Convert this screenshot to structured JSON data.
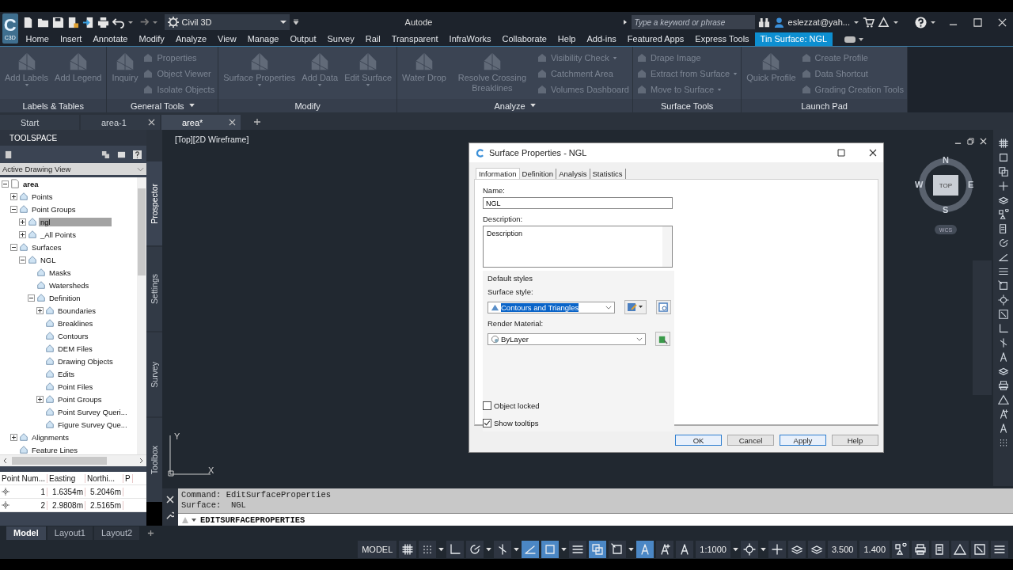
{
  "app_bar": {
    "logo": {
      "letter": "C",
      "caption": "C3D"
    },
    "workspace": "Civil 3D",
    "title": "Autode",
    "search_placeholder": "Type a keyword or phrase",
    "user": "eslezzat@yah..."
  },
  "ribbon_tabs": [
    {
      "label": "Home",
      "selected": false
    },
    {
      "label": "Insert",
      "selected": false
    },
    {
      "label": "Annotate",
      "selected": false
    },
    {
      "label": "Modify",
      "selected": false
    },
    {
      "label": "Analyze",
      "selected": false
    },
    {
      "label": "View",
      "selected": false
    },
    {
      "label": "Manage",
      "selected": false
    },
    {
      "label": "Output",
      "selected": false
    },
    {
      "label": "Survey",
      "selected": false
    },
    {
      "label": "Rail",
      "selected": false
    },
    {
      "label": "Transparent",
      "selected": false
    },
    {
      "label": "InfraWorks",
      "selected": false
    },
    {
      "label": "Collaborate",
      "selected": false
    },
    {
      "label": "Help",
      "selected": false
    },
    {
      "label": "Add-ins",
      "selected": false
    },
    {
      "label": "Featured Apps",
      "selected": false
    },
    {
      "label": "Express Tools",
      "selected": false
    },
    {
      "label": "Tin Surface: NGL",
      "selected": true
    }
  ],
  "ribbon_panels": [
    {
      "title": "Labels & Tables",
      "has_menu": false,
      "disabled": true,
      "tools": [
        {
          "label": "Add Labels",
          "kind": "large",
          "dropdown": true
        },
        {
          "label": "Add Legend",
          "kind": "large",
          "dropdown": false
        }
      ]
    },
    {
      "title": "General Tools",
      "has_menu": true,
      "disabled": true,
      "tools": [
        {
          "label": "Inquiry",
          "kind": "large",
          "dropdown": false
        },
        {
          "label": "Properties",
          "kind": "small",
          "dropdown": false
        },
        {
          "label": "Object Viewer",
          "kind": "small",
          "dropdown": false
        },
        {
          "label": "Isolate Objects",
          "kind": "small",
          "dropdown": false
        }
      ]
    },
    {
      "title": "Modify",
      "has_menu": false,
      "disabled": true,
      "tools": [
        {
          "label": "Surface Properties",
          "kind": "large",
          "dropdown": true
        },
        {
          "label": "Add Data",
          "kind": "large",
          "dropdown": true
        },
        {
          "label": "Edit Surface",
          "kind": "large",
          "dropdown": true
        }
      ]
    },
    {
      "title": "Analyze",
      "has_menu": true,
      "disabled": true,
      "tools": [
        {
          "label": "Water Drop",
          "kind": "large",
          "dropdown": false
        },
        {
          "label": "Resolve Crossing Breaklines",
          "kind": "large",
          "dropdown": false
        },
        {
          "label": "Visibility Check",
          "kind": "small",
          "dropdown": true
        },
        {
          "label": "Catchment Area",
          "kind": "small",
          "dropdown": false
        },
        {
          "label": "Volumes Dashboard",
          "kind": "small",
          "dropdown": false
        }
      ]
    },
    {
      "title": "Surface Tools",
      "has_menu": false,
      "disabled": true,
      "tools": [
        {
          "label": "Drape Image",
          "kind": "small",
          "dropdown": false
        },
        {
          "label": "Extract from Surface",
          "kind": "small",
          "dropdown": true
        },
        {
          "label": "Move to Surface",
          "kind": "small",
          "dropdown": true
        }
      ]
    },
    {
      "title": "Launch Pad",
      "has_menu": false,
      "disabled": true,
      "tools": [
        {
          "label": "Quick Profile",
          "kind": "large",
          "dropdown": false
        },
        {
          "label": "Create Profile",
          "kind": "small",
          "dropdown": false
        },
        {
          "label": "Data Shortcut",
          "kind": "small",
          "dropdown": false
        },
        {
          "label": "Grading Creation Tools",
          "kind": "small",
          "dropdown": false
        }
      ]
    }
  ],
  "doc_tabs": [
    {
      "label": "Start",
      "selected": false,
      "closable": false
    },
    {
      "label": "area-1",
      "selected": false,
      "closable": true
    },
    {
      "label": "area*",
      "selected": true,
      "closable": true
    }
  ],
  "toolspace": {
    "title": "TOOLSPACE",
    "view": "Active Drawing View",
    "tree": [
      {
        "label": "area",
        "expanded": true,
        "selected": false,
        "children": [
          {
            "label": "Points",
            "expanded": false,
            "selected": false
          },
          {
            "label": "Point Groups",
            "expanded": true,
            "selected": false,
            "children": [
              {
                "label": "ngl",
                "expanded": false,
                "selected": true
              },
              {
                "label": "_All Points",
                "expanded": false,
                "selected": false
              }
            ]
          },
          {
            "label": "Surfaces",
            "expanded": true,
            "selected": false,
            "children": [
              {
                "label": "NGL",
                "expanded": true,
                "selected": false,
                "children": [
                  {
                    "label": "Masks",
                    "selected": false
                  },
                  {
                    "label": "Watersheds",
                    "selected": false
                  },
                  {
                    "label": "Definition",
                    "expanded": true,
                    "selected": false,
                    "children": [
                      {
                        "label": "Boundaries",
                        "expanded": false,
                        "selected": false
                      },
                      {
                        "label": "Breaklines",
                        "selected": false
                      },
                      {
                        "label": "Contours",
                        "selected": false
                      },
                      {
                        "label": "DEM Files",
                        "selected": false
                      },
                      {
                        "label": "Drawing Objects",
                        "selected": false
                      },
                      {
                        "label": "Edits",
                        "selected": false
                      },
                      {
                        "label": "Point Files",
                        "selected": false
                      },
                      {
                        "label": "Point Groups",
                        "expanded": false,
                        "selected": false
                      },
                      {
                        "label": "Point Survey Queri...",
                        "selected": false
                      },
                      {
                        "label": "Figure Survey Que...",
                        "selected": false
                      }
                    ]
                  }
                ]
              }
            ]
          },
          {
            "label": "Alignments",
            "expanded": false,
            "selected": false
          },
          {
            "label": "Feature Lines",
            "selected": false
          }
        ]
      }
    ],
    "side_tabs": [
      {
        "label": "Prospector",
        "selected": true
      },
      {
        "label": "Settings",
        "selected": false
      },
      {
        "label": "Survey",
        "selected": false
      },
      {
        "label": "Toolbox",
        "selected": false
      }
    ]
  },
  "points_table": {
    "columns": [
      "Point Num...",
      "Easting",
      "Northi...",
      "P"
    ],
    "rows": [
      [
        "1",
        "1.6354m",
        "5.2046m",
        ""
      ],
      [
        "2",
        "2.9808m",
        "2.5165m",
        ""
      ]
    ]
  },
  "viewport": {
    "label": "[Top][2D Wireframe]",
    "viewcube": {
      "north": "N",
      "south": "S",
      "east": "E",
      "west": "W",
      "top": "TOP",
      "ucs": "WCS"
    },
    "axes": {
      "x": "X",
      "y": "Y"
    }
  },
  "dialog": {
    "title": "Surface Properties - NGL",
    "tabs": [
      {
        "label": "Information",
        "selected": true
      },
      {
        "label": "Definition",
        "selected": false
      },
      {
        "label": "Analysis",
        "selected": false
      },
      {
        "label": "Statistics",
        "selected": false
      }
    ],
    "name_label": "Name:",
    "name": "NGL",
    "description_label": "Description:",
    "description": "Description",
    "group_title": "Default styles",
    "surface_style_label": "Surface style:",
    "surface_style": "Contours and Triangles",
    "surface_style_highlighted": true,
    "render_material_label": "Render Material:",
    "render_material": "ByLayer",
    "checkboxes": [
      {
        "label": "Object locked",
        "checked": false
      },
      {
        "label": "Show tooltips",
        "checked": true
      }
    ],
    "buttons": [
      {
        "label": "OK",
        "highlighted": true
      },
      {
        "label": "Cancel",
        "highlighted": false
      },
      {
        "label": "Apply",
        "highlighted": true
      },
      {
        "label": "Help",
        "highlighted": false
      }
    ]
  },
  "command_line": {
    "history": [
      "Command: EditSurfaceProperties",
      "Surface:  NGL"
    ],
    "input": "EDITSURFACEPROPERTIES"
  },
  "layout_tabs": [
    {
      "label": "Model",
      "selected": true
    },
    {
      "label": "Layout1",
      "selected": false
    },
    {
      "label": "Layout2",
      "selected": false
    }
  ],
  "status_bar": [
    {
      "kind": "text",
      "label": "MODEL"
    },
    {
      "kind": "icon",
      "on": false
    },
    {
      "kind": "icon",
      "on": false
    },
    {
      "kind": "caret"
    },
    {
      "kind": "icon",
      "on": false
    },
    {
      "kind": "icon",
      "on": false
    },
    {
      "kind": "caret"
    },
    {
      "kind": "icon",
      "on": false
    },
    {
      "kind": "caret"
    },
    {
      "kind": "icon",
      "on": true
    },
    {
      "kind": "icon",
      "on": true
    },
    {
      "kind": "caret"
    },
    {
      "kind": "icon",
      "on": false
    },
    {
      "kind": "icon",
      "on": true
    },
    {
      "kind": "icon",
      "on": false
    },
    {
      "kind": "caret"
    },
    {
      "kind": "icon",
      "on": true
    },
    {
      "kind": "icon",
      "on": false
    },
    {
      "kind": "icon",
      "on": false
    },
    {
      "kind": "text",
      "label": "1:1000"
    },
    {
      "kind": "caret"
    },
    {
      "kind": "icon",
      "on": false
    },
    {
      "kind": "caret"
    },
    {
      "kind": "icon",
      "on": false
    },
    {
      "kind": "icon",
      "on": false
    },
    {
      "kind": "icon",
      "on": false
    },
    {
      "kind": "text",
      "label": "3.500"
    },
    {
      "kind": "text",
      "label": "1.400"
    },
    {
      "kind": "icon",
      "on": false
    },
    {
      "kind": "icon",
      "on": false
    },
    {
      "kind": "icon",
      "on": false
    },
    {
      "kind": "icon",
      "on": false
    },
    {
      "kind": "icon",
      "on": false
    },
    {
      "kind": "icon",
      "on": false
    }
  ]
}
